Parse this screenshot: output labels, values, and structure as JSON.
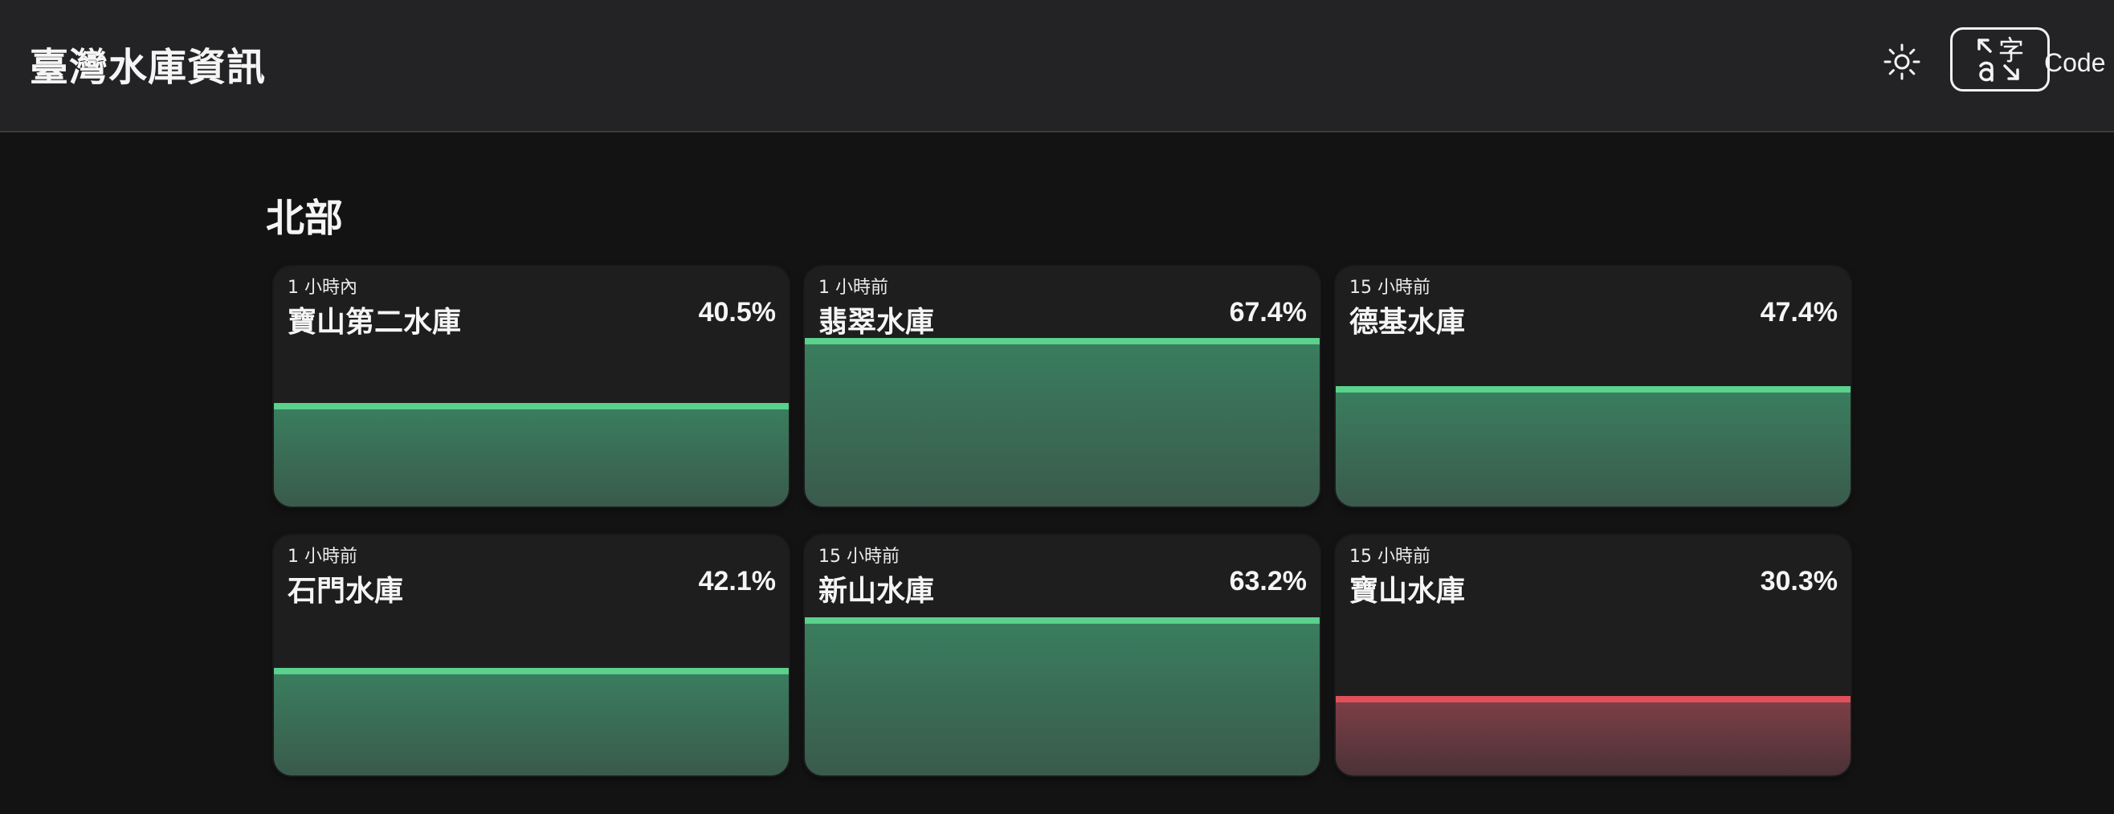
{
  "header": {
    "title": "臺灣水庫資訊",
    "theme_icon": "sun-icon",
    "lang_icon": "translate-icon",
    "code_label": "Code"
  },
  "region": {
    "title": "北部"
  },
  "colors": {
    "ok": "#5ad18c",
    "low": "#e0505a",
    "background": "#131313",
    "card": "#1e1e1f"
  },
  "reservoirs": [
    {
      "time": "1 小時內",
      "name": "寶山第二水庫",
      "percent": "40.5%",
      "level": 0.405,
      "status": "ok"
    },
    {
      "time": "1 小時前",
      "name": "翡翠水庫",
      "percent": "67.4%",
      "level": 0.674,
      "status": "ok"
    },
    {
      "time": "15 小時前",
      "name": "德基水庫",
      "percent": "47.4%",
      "level": 0.474,
      "status": "ok"
    },
    {
      "time": "1 小時前",
      "name": "石門水庫",
      "percent": "42.1%",
      "level": 0.421,
      "status": "ok"
    },
    {
      "time": "15 小時前",
      "name": "新山水庫",
      "percent": "63.2%",
      "level": 0.632,
      "status": "ok"
    },
    {
      "time": "15 小時前",
      "name": "寶山水庫",
      "percent": "30.3%",
      "level": 0.303,
      "status": "low"
    }
  ]
}
